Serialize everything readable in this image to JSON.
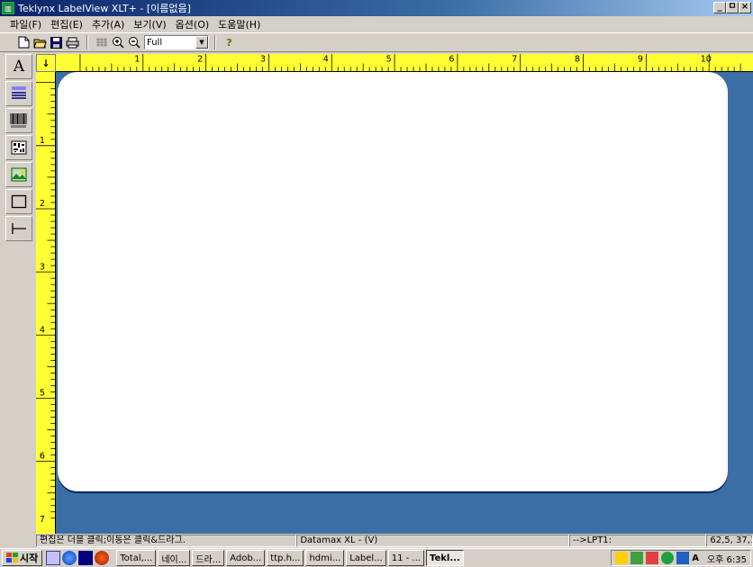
{
  "window": {
    "title": "Teklynx LabelView XLT+  - [이름없음]",
    "btn_min": "_",
    "btn_max": "ㅁ",
    "btn_close": "×"
  },
  "menu": [
    {
      "label": "파일(F)"
    },
    {
      "label": "편집(E)"
    },
    {
      "label": "추가(A)"
    },
    {
      "label": "보기(V)"
    },
    {
      "label": "옵션(O)"
    },
    {
      "label": "도움말(H)"
    }
  ],
  "toolbar": {
    "zoom_value": "Full",
    "zoom_arrow": "▼",
    "help_glyph": "?"
  },
  "ruler": {
    "corner_glyph": "↓",
    "h_labels": [
      "1",
      "2",
      "3",
      "4",
      "5",
      "6",
      "7",
      "8",
      "9",
      "10"
    ],
    "v_labels": [
      "1",
      "2",
      "3",
      "4",
      "5",
      "6",
      "7"
    ]
  },
  "tools": {
    "text_glyph": "A"
  },
  "status": {
    "hint": "편집은 더블 클릭;이동은 클릭&드라그.",
    "printer": "Datamax XL - (V)",
    "port": "-->LPT1:",
    "coords": "62,5, 37,1"
  },
  "taskbar": {
    "start_label": "시작",
    "tasks": [
      {
        "label": "Total,..."
      },
      {
        "label": "네이..."
      },
      {
        "label": "드라..."
      },
      {
        "label": "Adob..."
      },
      {
        "label": "ttp.h..."
      },
      {
        "label": "hdmi..."
      },
      {
        "label": "Label..."
      },
      {
        "label": "11 - ..."
      },
      {
        "label": "Tekl..."
      }
    ],
    "tray_text": "A",
    "clock": "오후 6:35"
  }
}
